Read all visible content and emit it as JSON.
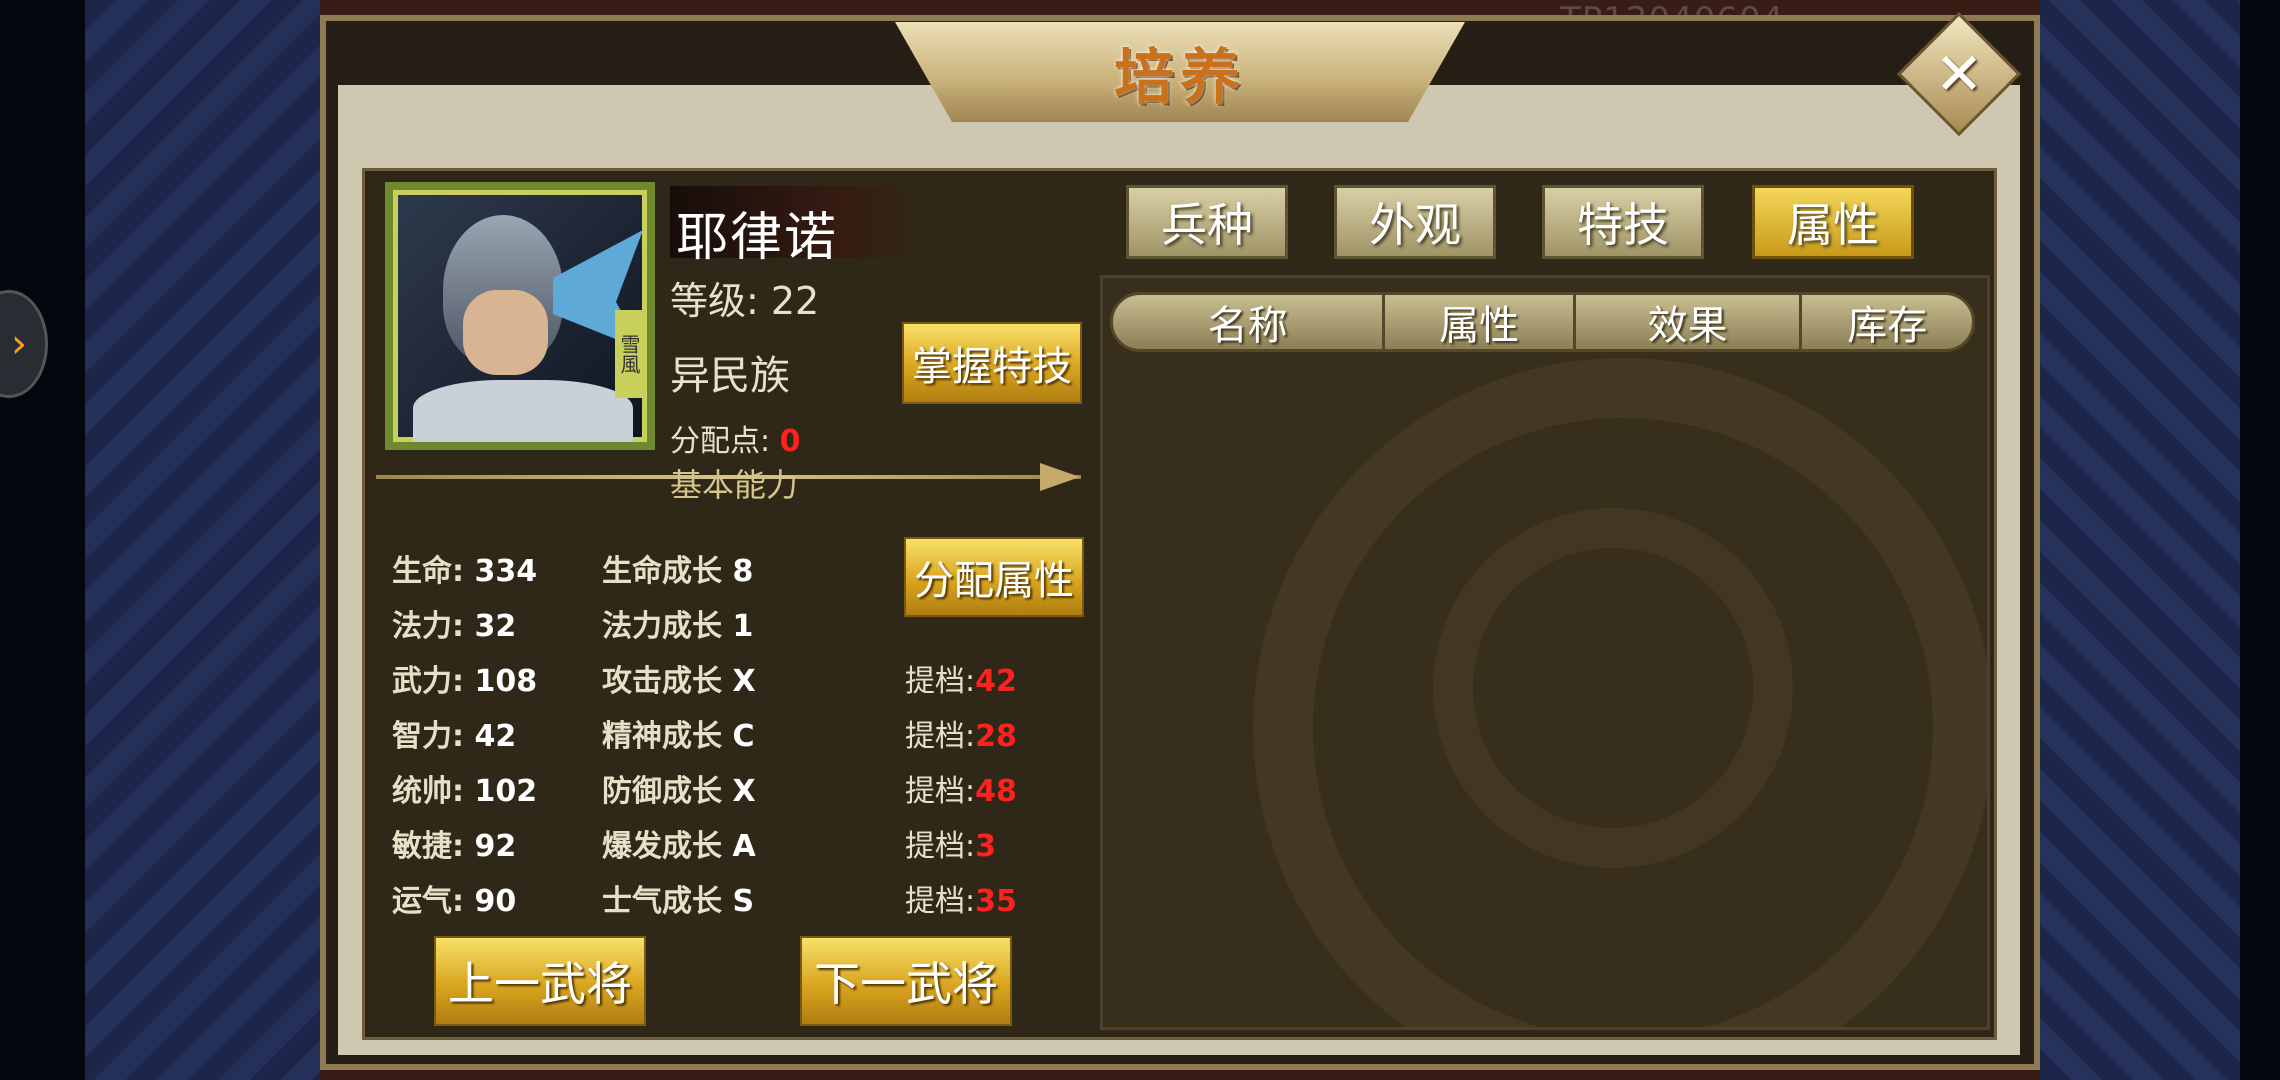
{
  "window": {
    "title": "培养",
    "bg_tag": "TP12040604"
  },
  "hero": {
    "name": "耶律诺",
    "level": "等级: 22",
    "race": "异民族",
    "alloc_label": "分配点: ",
    "alloc_value": "0",
    "portrait_tag": "雪風"
  },
  "buttons": {
    "master_skill": "掌握特技",
    "assign_attributes": "分配属性",
    "prev_general": "上一武将",
    "next_general": "下一武将"
  },
  "section_title": "基本能力",
  "stats": [
    {
      "label": "生命:",
      "value": "334",
      "growth_label": "生命成长",
      "growth_value": "8"
    },
    {
      "label": "法力:",
      "value": "32",
      "growth_label": "法力成长",
      "growth_value": "1"
    },
    {
      "label": "武力:",
      "value": "108",
      "growth_label": "攻击成长",
      "growth_value": "X",
      "tier_label": "提档:",
      "tier_value": "42"
    },
    {
      "label": "智力:",
      "value": "42",
      "growth_label": "精神成长",
      "growth_value": "C",
      "tier_label": "提档:",
      "tier_value": "28"
    },
    {
      "label": "统帅:",
      "value": "102",
      "growth_label": "防御成长",
      "growth_value": "X",
      "tier_label": "提档:",
      "tier_value": "48"
    },
    {
      "label": "敏捷:",
      "value": "92",
      "growth_label": "爆发成长",
      "growth_value": "A",
      "tier_label": "提档:",
      "tier_value": "3"
    },
    {
      "label": "运气:",
      "value": "90",
      "growth_label": "士气成长",
      "growth_value": "S",
      "tier_label": "提档:",
      "tier_value": "35"
    }
  ],
  "tabs": [
    {
      "label": "兵种",
      "active": false
    },
    {
      "label": "外观",
      "active": false
    },
    {
      "label": "特技",
      "active": false
    },
    {
      "label": "属性",
      "active": true
    }
  ],
  "table": {
    "columns": [
      "名称",
      "属性",
      "效果",
      "库存"
    ]
  },
  "colors": {
    "accent_gold": "#d9a520",
    "highlight_red": "#ff2020"
  }
}
